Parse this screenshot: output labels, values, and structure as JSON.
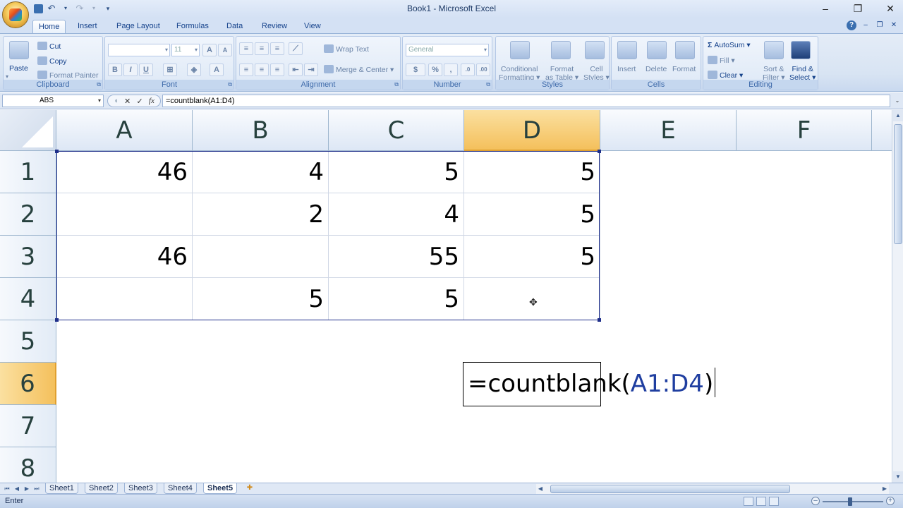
{
  "app": {
    "title": "Book1 - Microsoft Excel",
    "accent": "#15428b"
  },
  "quick_access": {
    "save_icon": "save-icon",
    "undo_icon": "undo-icon",
    "redo_icon": "redo-icon",
    "customize_icon": "customize-icon"
  },
  "ribbon_tabs": [
    "Home",
    "Insert",
    "Page Layout",
    "Formulas",
    "Data",
    "Review",
    "View"
  ],
  "active_tab": "Home",
  "ribbon": {
    "clipboard": {
      "label": "Clipboard",
      "paste": "Paste",
      "cut": "Cut",
      "copy": "Copy",
      "format_painter": "Format Painter"
    },
    "font": {
      "label": "Font",
      "font_name": "",
      "font_size": "11",
      "bold": "B",
      "italic": "I",
      "underline": "U"
    },
    "alignment": {
      "label": "Alignment",
      "wrap_text": "Wrap Text",
      "merge_center": "Merge & Center"
    },
    "number": {
      "label": "Number",
      "format": "General",
      "percent": "%",
      "comma": ","
    },
    "styles": {
      "label": "Styles",
      "conditional_1": "Conditional",
      "conditional_2": "Formatting",
      "format_table_1": "Format",
      "format_table_2": "as Table",
      "cell_styles_1": "Cell",
      "cell_styles_2": "Styles"
    },
    "cells": {
      "label": "Cells",
      "insert": "Insert",
      "delete": "Delete",
      "format": "Format"
    },
    "editing": {
      "label": "Editing",
      "autosum": "AutoSum",
      "fill": "Fill",
      "clear": "Clear",
      "sort_1": "Sort &",
      "sort_2": "Filter",
      "find_1": "Find &",
      "find_2": "Select"
    }
  },
  "formula_bar": {
    "name_box": "ABS",
    "cancel": "✕",
    "enter": "✓",
    "fx": "fx",
    "formula": "=countblank(A1:D4)"
  },
  "columns": [
    "A",
    "B",
    "C",
    "D",
    "E",
    "F"
  ],
  "selected_column": "D",
  "rows": [
    "1",
    "2",
    "3",
    "4",
    "5",
    "6",
    "7",
    "8"
  ],
  "selected_row": "6",
  "cells": {
    "A1": "46",
    "B1": "4",
    "C1": "5",
    "D1": "5",
    "A2": "",
    "B2": "2",
    "C2": "4",
    "D2": "5",
    "A3": "46",
    "B3": "",
    "C3": "55",
    "D3": "5",
    "A4": "",
    "B4": "5",
    "C4": "5",
    "D4": ""
  },
  "edit_cell": {
    "address": "D6",
    "prefix": "=countblank(",
    "reference": "A1:D4",
    "suffix": ")",
    "reference_color": "#1f3ea0"
  },
  "sheets": [
    "Sheet1",
    "Sheet2",
    "Sheet3",
    "Sheet4",
    "Sheet5"
  ],
  "active_sheet": "Sheet5",
  "status": {
    "mode": "Enter"
  }
}
